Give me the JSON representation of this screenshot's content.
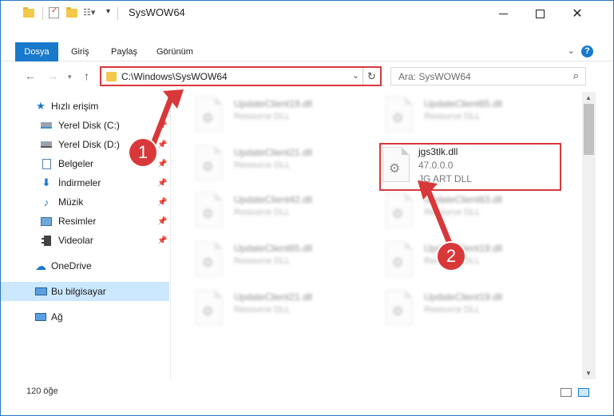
{
  "window": {
    "title": "SysWOW64"
  },
  "ribbon": {
    "tabs": [
      "Dosya",
      "Giriş",
      "Paylaş",
      "Görünüm"
    ],
    "help": "?"
  },
  "address": {
    "path": "C:\\Windows\\SysWOW64",
    "search_placeholder": "Ara: SysWOW64"
  },
  "sidebar": {
    "items": [
      {
        "label": "Hızlı erişim",
        "icon": "star-icon"
      },
      {
        "label": "Yerel Disk (C:)",
        "icon": "drive-icon"
      },
      {
        "label": "Yerel Disk (D:)",
        "icon": "drive-icon"
      },
      {
        "label": "Belgeler",
        "icon": "documents-icon"
      },
      {
        "label": "İndirmeler",
        "icon": "download-icon"
      },
      {
        "label": "Müzik",
        "icon": "music-icon"
      },
      {
        "label": "Resimler",
        "icon": "pictures-icon"
      },
      {
        "label": "Videolar",
        "icon": "videos-icon"
      },
      {
        "label": "OneDrive",
        "icon": "cloud-icon"
      },
      {
        "label": "Bu bilgisayar",
        "icon": "computer-icon"
      },
      {
        "label": "Ağ",
        "icon": "network-icon"
      }
    ]
  },
  "files": {
    "left": [
      {
        "name": "UpdateClient19.dll",
        "desc": "Resource DLL"
      },
      {
        "name": "UpdateClient21.dll",
        "desc": "Resource DLL"
      },
      {
        "name": "UpdateClient42.dll",
        "desc": "Resource DLL"
      },
      {
        "name": "UpdateClient65.dll",
        "desc": "Resource DLL"
      },
      {
        "name": "UpdateClient21.dll",
        "desc": "Resource DLL"
      }
    ],
    "right": [
      {
        "name": "UpdateClient65.dll",
        "desc": "Resource DLL"
      },
      {
        "name": "UpdateClient63.dll",
        "desc": "Resource DLL"
      },
      {
        "name": "UpdateClient19.dll",
        "desc": "Resource DLL"
      },
      {
        "name": "UpdateClient19.dll",
        "desc": "Resource DLL"
      }
    ],
    "target": {
      "name": "jgs3tlk.dll",
      "version": "47.0.0.0",
      "desc": "JG ART DLL"
    }
  },
  "status": {
    "count": "120 öğe"
  },
  "annotations": {
    "step1": "1",
    "step2": "2",
    "color": "#d9383a"
  }
}
